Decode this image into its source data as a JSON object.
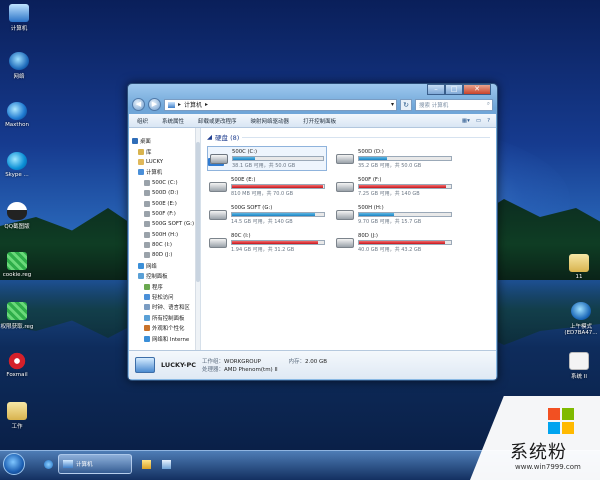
{
  "desktop": {
    "icons_left": [
      {
        "label": "计算机",
        "icon": "computer-icon"
      },
      {
        "label": "网络",
        "icon": "network-icon"
      },
      {
        "label": "Maxthon",
        "icon": "maxthon-icon"
      },
      {
        "label": "Skype ...",
        "icon": "skype-icon"
      },
      {
        "label": "QQ截图版",
        "icon": "qq-icon"
      },
      {
        "label": "cookie.reg",
        "icon": "reg-file-icon"
      },
      {
        "label": "权限获取.reg",
        "icon": "reg-file-icon"
      },
      {
        "label": "Foxmail",
        "icon": "foxmail-icon"
      },
      {
        "label": "工作",
        "icon": "folder-icon"
      }
    ],
    "icons_right": [
      {
        "label": "11",
        "icon": "folder-icon"
      },
      {
        "label": "上午模式 (ED7BA47...",
        "icon": "network-shortcut-icon"
      },
      {
        "label": "系统 II",
        "icon": "file-icon"
      }
    ]
  },
  "window": {
    "address": {
      "path": "计算机",
      "search_placeholder": "搜索 计算机"
    },
    "controls": {
      "minimize": "–",
      "maximize": "□",
      "close": "✕"
    },
    "toolbar": [
      "组织",
      "系统属性",
      "卸载或更改程序",
      "映射网络驱动器",
      "打开控制面板"
    ],
    "nav": [
      {
        "label": "桌面",
        "indent": 0,
        "icon": "desktop-icon"
      },
      {
        "label": "库",
        "indent": 1,
        "icon": "library-icon"
      },
      {
        "label": "LUCKY",
        "indent": 1,
        "icon": "user-icon"
      },
      {
        "label": "计算机",
        "indent": 1,
        "icon": "computer-icon"
      },
      {
        "label": "500C (C:)",
        "indent": 2,
        "icon": "drive-icon"
      },
      {
        "label": "500D (D:)",
        "indent": 2,
        "icon": "drive-icon"
      },
      {
        "label": "500E (E:)",
        "indent": 2,
        "icon": "drive-icon"
      },
      {
        "label": "500F (F:)",
        "indent": 2,
        "icon": "drive-icon"
      },
      {
        "label": "500G SOFT (G:)",
        "indent": 2,
        "icon": "drive-icon"
      },
      {
        "label": "500H (H:)",
        "indent": 2,
        "icon": "drive-icon"
      },
      {
        "label": "80C (I:)",
        "indent": 2,
        "icon": "drive-icon"
      },
      {
        "label": "80D (J:)",
        "indent": 2,
        "icon": "drive-icon"
      },
      {
        "label": "网络",
        "indent": 1,
        "icon": "network-icon"
      },
      {
        "label": "控制面板",
        "indent": 1,
        "icon": "control-panel-icon"
      },
      {
        "label": "程序",
        "indent": 2,
        "icon": "programs-icon"
      },
      {
        "label": "轻松访问",
        "indent": 2,
        "icon": "accessibility-icon"
      },
      {
        "label": "时钟、语言和区",
        "indent": 2,
        "icon": "clock-icon"
      },
      {
        "label": "所有控制面板",
        "indent": 2,
        "icon": "control-panel-icon"
      },
      {
        "label": "外观和个性化",
        "indent": 2,
        "icon": "appearance-icon"
      },
      {
        "label": "网络和 Interne",
        "indent": 2,
        "icon": "network-icon"
      }
    ],
    "group_title": "硬盘 (8)",
    "drives": [
      {
        "name": "500C (C:)",
        "free": "38.1 GB 可用，共 50.0 GB",
        "used": 0.24,
        "color": "#1c84c4",
        "system": true,
        "selected": true
      },
      {
        "name": "500D (D:)",
        "free": "35.2 GB 可用，共 50.0 GB",
        "used": 0.3,
        "color": "#1c84c4",
        "system": false,
        "selected": false
      },
      {
        "name": "500E (E:)",
        "free": "810 MB 可用，共 70.0 GB",
        "used": 0.99,
        "color": "#c9161d",
        "system": false,
        "selected": false
      },
      {
        "name": "500F (F:)",
        "free": "7.25 GB 可用，共 140 GB",
        "used": 0.95,
        "color": "#c9161d",
        "system": false,
        "selected": false
      },
      {
        "name": "500G SOFT (G:)",
        "free": "14.5 GB 可用，共 140 GB",
        "used": 0.9,
        "color": "#1c84c4",
        "system": false,
        "selected": false
      },
      {
        "name": "500H (H:)",
        "free": "9.70 GB 可用，共 15.7 GB",
        "used": 0.38,
        "color": "#1c84c4",
        "system": false,
        "selected": false
      },
      {
        "name": "80C (I:)",
        "free": "1.94 GB 可用，共 31.2 GB",
        "used": 0.94,
        "color": "#c9161d",
        "system": false,
        "selected": false
      },
      {
        "name": "80D (J:)",
        "free": "40.0 GB 可用，共 43.2 GB",
        "used": 0.93,
        "color": "#c9161d",
        "system": false,
        "selected": false
      }
    ],
    "details": {
      "pc_name": "LUCKY-PC",
      "workgroup_label": "工作组：",
      "workgroup": "WORKGROUP",
      "memory_label": "内存：",
      "memory": "2.00 GB",
      "cpu_label": "处理器：",
      "cpu": "AMD Phenom(tm) II"
    }
  },
  "taskbar": {
    "window_label": "计算机"
  },
  "watermark": {
    "title": "系统粉",
    "url": "www.win7999.com"
  }
}
